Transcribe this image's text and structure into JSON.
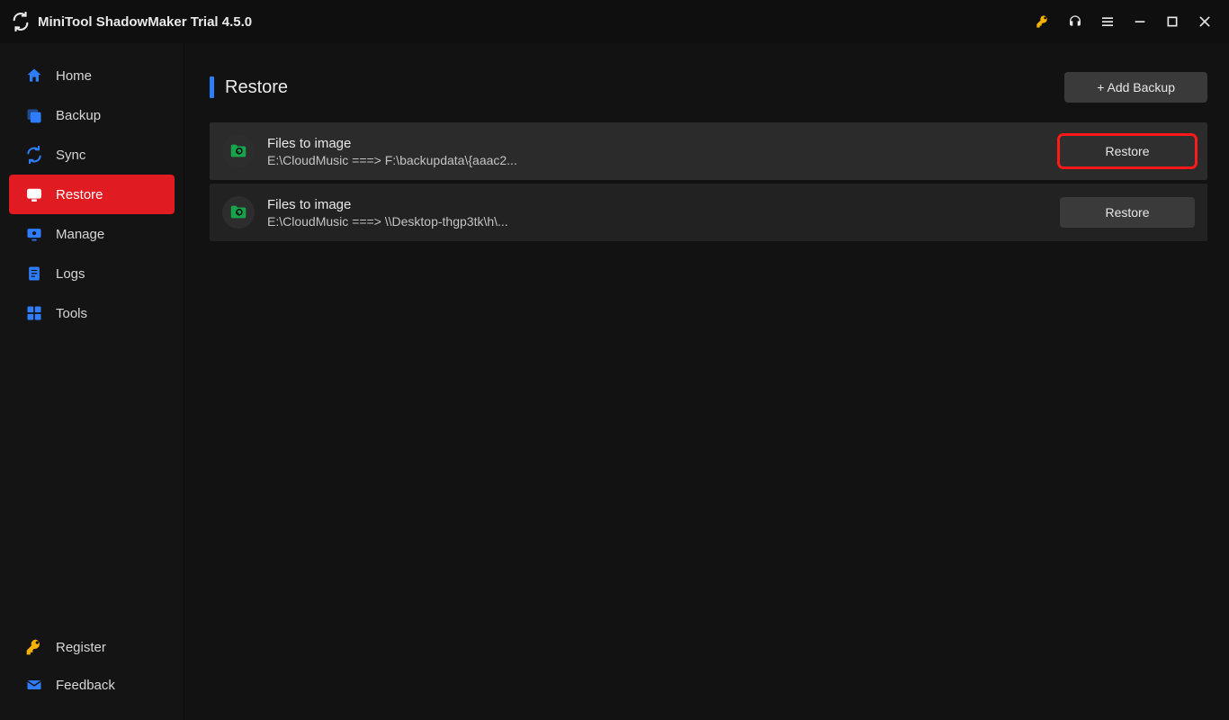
{
  "titlebar": {
    "app_title": "MiniTool ShadowMaker Trial 4.5.0"
  },
  "sidebar": {
    "items": [
      {
        "label": "Home"
      },
      {
        "label": "Backup"
      },
      {
        "label": "Sync"
      },
      {
        "label": "Restore"
      },
      {
        "label": "Manage"
      },
      {
        "label": "Logs"
      },
      {
        "label": "Tools"
      }
    ],
    "active_index": 3,
    "bottom": [
      {
        "label": "Register"
      },
      {
        "label": "Feedback"
      }
    ]
  },
  "page": {
    "title": "Restore",
    "add_backup_label": "+ Add Backup"
  },
  "backups": [
    {
      "title": "Files to image",
      "path": "E:\\CloudMusic ===> F:\\backupdata\\{aaac2...",
      "restore_label": "Restore",
      "highlighted": true
    },
    {
      "title": "Files to image",
      "path": "E:\\CloudMusic ===> \\\\Desktop-thgp3tk\\h\\...",
      "restore_label": "Restore",
      "highlighted": false
    }
  ]
}
